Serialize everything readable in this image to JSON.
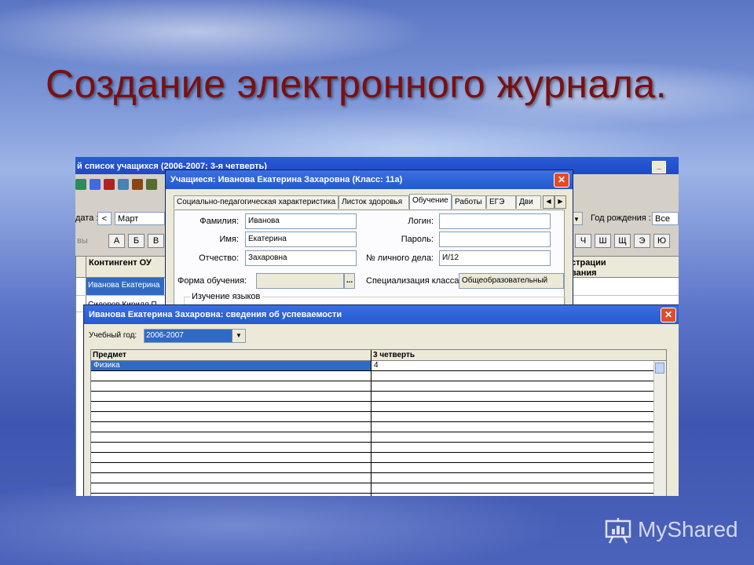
{
  "slide": {
    "title": "Создание электронного журнала."
  },
  "main_window": {
    "title": "й список учащихся (2006-2007; 3-я четверть)",
    "date_label": "дата :",
    "month_value": "Март",
    "birth_year_label": "Год рождения :",
    "birth_year_value": "Все",
    "letters_left": [
      "А",
      "Б",
      "В"
    ],
    "letters_right": [
      "Ч",
      "Ш",
      "Щ",
      "Э",
      "Ю"
    ],
    "list_label": "вы",
    "col_contingent": "Контингент ОУ",
    "col_registration": "страции",
    "col_sub": "вания",
    "students": [
      "Иванова Екатерина",
      "Сидоров Кирилл П"
    ]
  },
  "student_dialog": {
    "title": "Учащиеся: Иванова Екатерина Захаровна (Класс: 11а)",
    "close_glyph": "✕",
    "tabs": [
      "Социально-педагогическая характеристика",
      "Листок здоровья",
      "Обучение",
      "Работы",
      "ЕГЭ",
      "Дви"
    ],
    "active_tab": "Обучение",
    "fields": {
      "surname_label": "Фамилия:",
      "surname_value": "Иванова",
      "name_label": "Имя:",
      "name_value": "Екатерина",
      "patronymic_label": "Отчество:",
      "patronymic_value": "Захаровна",
      "login_label": "Логин:",
      "login_value": "",
      "password_label": "Пароль:",
      "password_value": "",
      "file_no_label": "№ личного дела:",
      "file_no_value": "И/12",
      "study_form_label": "Форма обучения:",
      "study_form_value": "",
      "browse_glyph": "...",
      "specialization_label": "Специализация класса:",
      "specialization_value": "Общеобразовательный",
      "languages_group": "Изучение языков"
    }
  },
  "performance_dialog": {
    "title": "Иванова Екатерина Захаровна: сведения об успеваемости",
    "close_glyph": "✕",
    "year_label": "Учебный год:",
    "year_value": "2006-2007",
    "columns": [
      "Предмет",
      "3 четверть"
    ],
    "rows": [
      {
        "subject": "Физика",
        "grade": "4"
      }
    ]
  },
  "watermark": {
    "text": "MyShared",
    "icon": "presentation-icon"
  }
}
